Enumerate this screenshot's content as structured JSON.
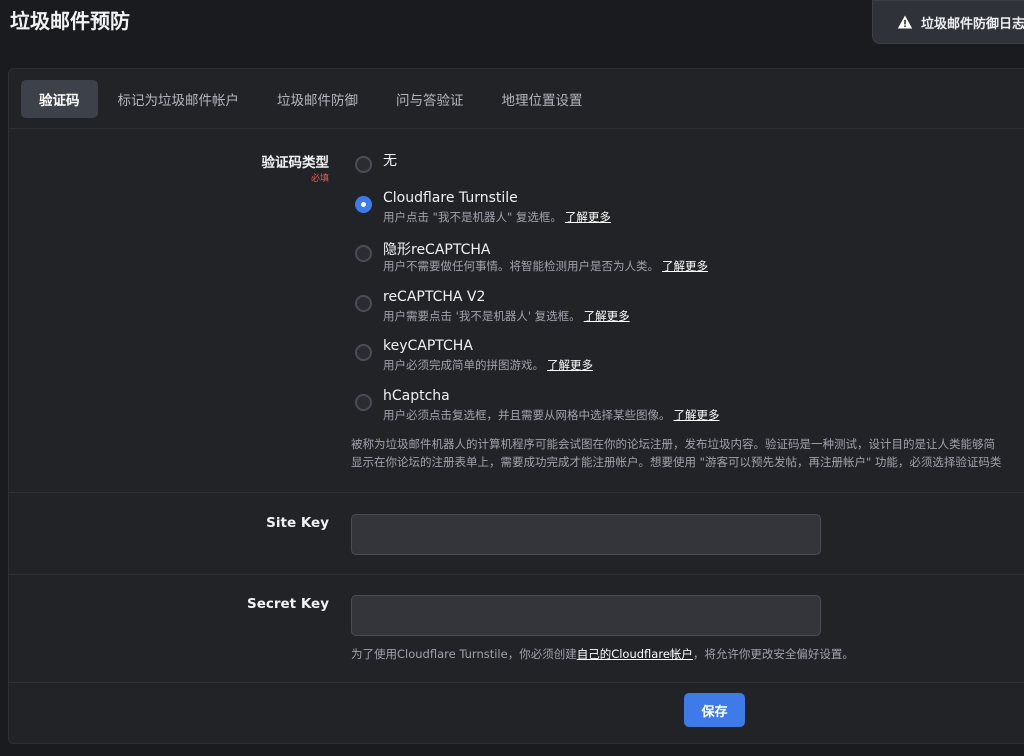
{
  "page": {
    "title": "垃圾邮件预防"
  },
  "header": {
    "log_button_label": "垃圾邮件防御日志"
  },
  "tabs": [
    {
      "label": "验证码",
      "active": true
    },
    {
      "label": "标记为垃圾邮件帐户",
      "active": false
    },
    {
      "label": "垃圾邮件防御",
      "active": false
    },
    {
      "label": "问与答验证",
      "active": false
    },
    {
      "label": "地理位置设置",
      "active": false
    }
  ],
  "captcha": {
    "label": "验证码类型",
    "required": "必填",
    "options": [
      {
        "label": "无",
        "description": "",
        "learn_more": "",
        "checked": false
      },
      {
        "label": "Cloudflare Turnstile",
        "description": "用户点击 \"我不是机器人\" 复选框。",
        "learn_more": "了解更多",
        "checked": true
      },
      {
        "label": "隐形reCAPTCHA",
        "description": "用户不需要做任何事情。将智能检测用户是否为人类。",
        "learn_more": "了解更多",
        "checked": false
      },
      {
        "label": "reCAPTCHA V2",
        "description": "用户需要点击 '我不是机器人' 复选框。",
        "learn_more": "了解更多",
        "checked": false
      },
      {
        "label": "keyCAPTCHA",
        "description": "用户必须完成简单的拼图游戏。",
        "learn_more": "了解更多",
        "checked": false
      },
      {
        "label": "hCaptcha",
        "description": "用户必须点击复选框，并且需要从网格中选择某些图像。",
        "learn_more": "了解更多",
        "checked": false
      }
    ],
    "help_line1": "被称为垃圾邮件机器人的计算机程序可能会试图在你的论坛注册，发布垃圾内容。验证码是一种测试，设计目的是让人类能够简",
    "help_line2": "显示在你论坛的注册表单上，需要成功完成才能注册帐户。想要使用 \"游客可以预先发帖，再注册帐户\" 功能，必须选择验证码类"
  },
  "site_key": {
    "label": "Site Key",
    "value": ""
  },
  "secret_key": {
    "label": "Secret Key",
    "value": "",
    "hint_before": "为了使用Cloudflare Turnstile，你必须创建",
    "hint_link": "自己的Cloudflare帐户",
    "hint_after": "，将允许你更改安全偏好设置。"
  },
  "save_button": {
    "label": "保存"
  },
  "colors": {
    "accent": "#3f7be8",
    "required": "#e35b5b",
    "background": "#1a1b1f",
    "panel": "#222327"
  }
}
